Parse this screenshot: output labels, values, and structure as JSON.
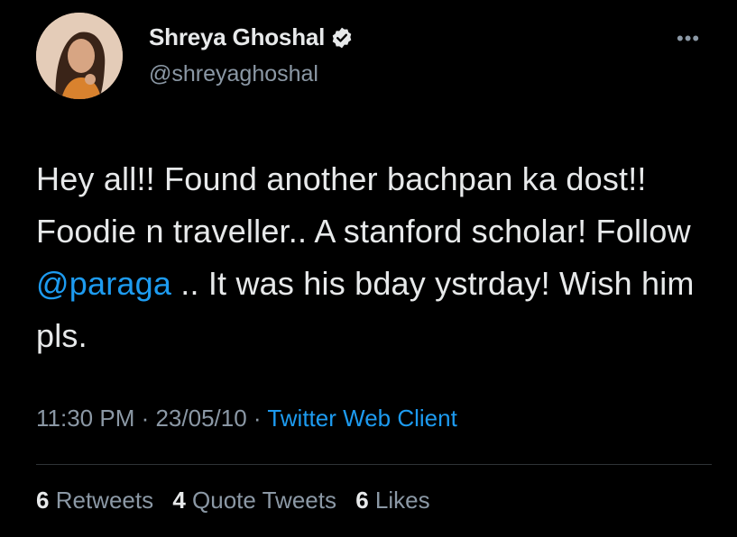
{
  "author": {
    "display_name": "Shreya Ghoshal",
    "handle": "@shreyaghoshal",
    "verified_icon": "verified-badge-icon",
    "avatar_icon": "profile-photo"
  },
  "more_icon": "•••",
  "tweet": {
    "text_before": "Hey all!! Found another bachpan ka dost!! Foodie n traveller.. A stanford scholar! Follow ",
    "mention": "@paraga",
    "text_after": " .. It was his bday ystrday! Wish him pls."
  },
  "meta": {
    "time": "11:30 PM",
    "separator": " · ",
    "date": "23/05/10",
    "client": "Twitter Web Client"
  },
  "stats": {
    "retweets_count": "6",
    "retweets_label": "Retweets",
    "quotes_count": "4",
    "quotes_label": "Quote Tweets",
    "likes_count": "6",
    "likes_label": "Likes"
  },
  "colors": {
    "background": "#000000",
    "text": "#e7e9ea",
    "secondary": "#8b98a5",
    "accent": "#1d9bf0"
  }
}
